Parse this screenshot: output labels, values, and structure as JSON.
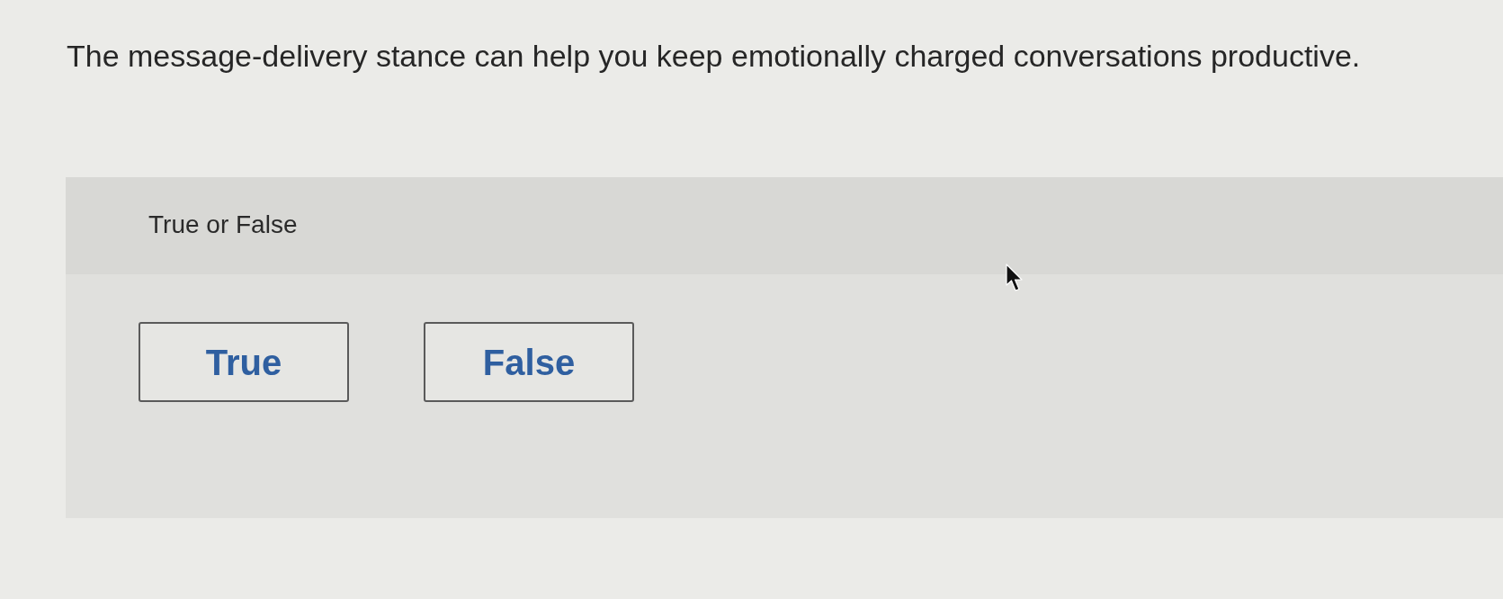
{
  "question": {
    "text": "The message-delivery stance can help you keep emotionally charged conversations productive."
  },
  "answer_panel": {
    "prompt": "True or False",
    "options": [
      {
        "label": "True",
        "selected": false
      },
      {
        "label": "False",
        "selected": false
      }
    ]
  }
}
